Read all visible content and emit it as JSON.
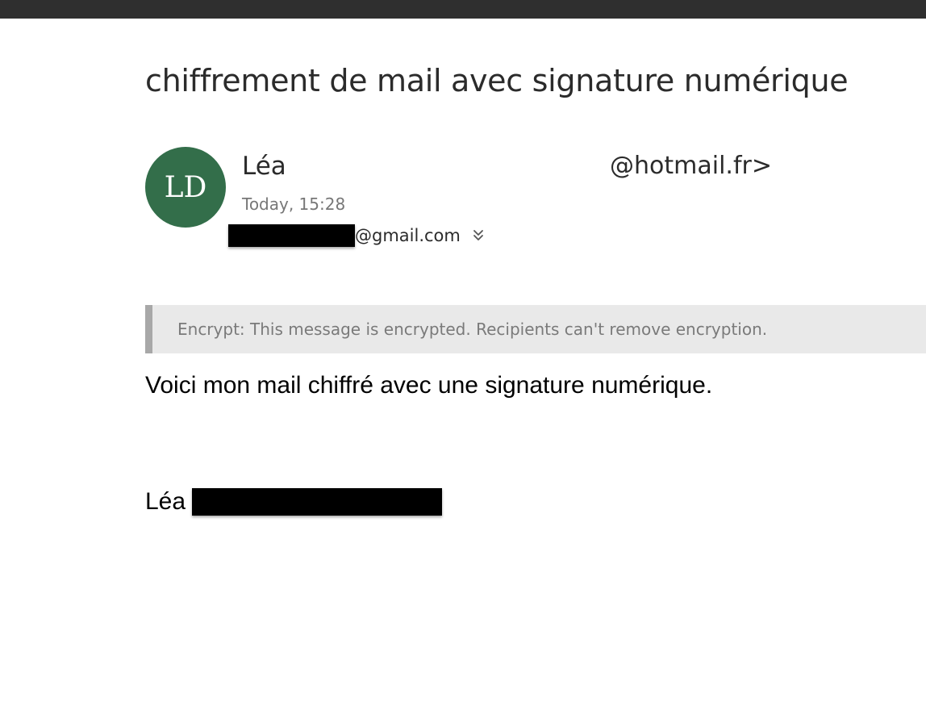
{
  "message": {
    "subject": "chiffrement de mail avec signature numérique",
    "sender": {
      "initials": "LD",
      "avatar_color": "#336e4a",
      "name": "Léa",
      "email_suffix": "@hotmail.fr>"
    },
    "timestamp": "Today, 15:28",
    "recipient": {
      "domain": "@gmail.com",
      "expand_icon": "chevron-double-down-icon"
    },
    "encryption_notice": "Encrypt: This message is encrypted. Recipients can't remove encryption.",
    "body": "Voici mon mail chiffré avec une signature numérique.",
    "signature_name": "Léa"
  },
  "colors": {
    "topbar": "#2f2f2f",
    "banner_bg": "#e9e9e9",
    "banner_border": "#a8a8a8"
  }
}
